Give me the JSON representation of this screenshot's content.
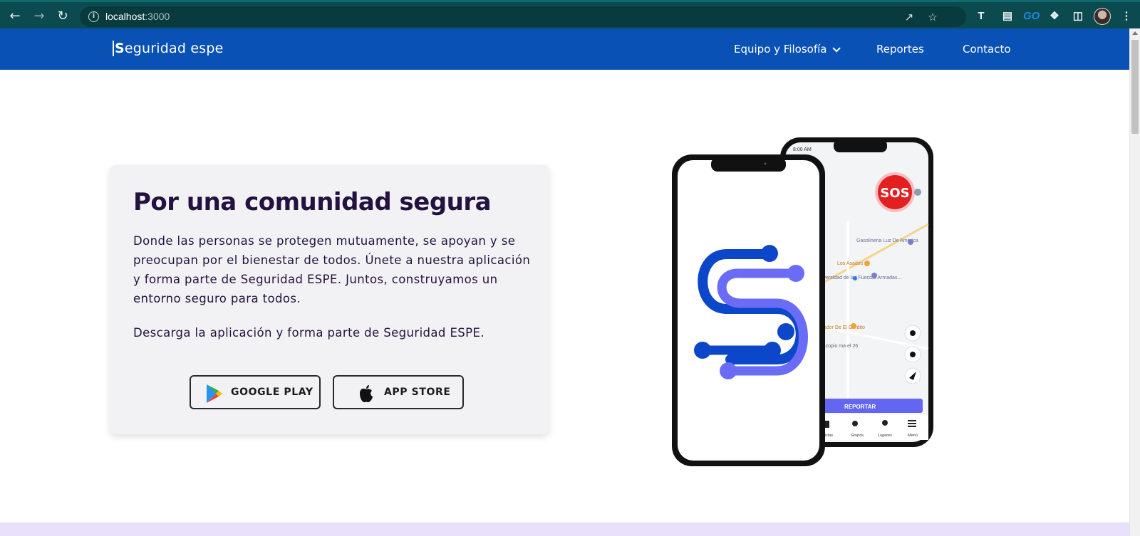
{
  "browser": {
    "url_host": "localhost",
    "url_port": ":3000",
    "extension_go_label": "GO"
  },
  "site": {
    "brand_rest": "eguridad espe",
    "brand_initial": "S",
    "nav": {
      "team": "Equipo y Filosofía",
      "reports": "Reportes",
      "contact": "Contacto"
    }
  },
  "hero": {
    "title": "Por una comunidad segura",
    "description": "Donde las personas se protegen mutuamente, se apoyan y se preocupan por el bienestar de todos. Únete a nuestra aplicación y forma parte de Seguridad ESPE. Juntos, construyamos un entorno seguro para todos.",
    "cta": "Descarga la aplicación y forma parte de Seguridad ESPE.",
    "google_play": "GOOGLE PLAY",
    "app_store": "APP STORE"
  },
  "phone_screen": {
    "time": "8:00 AM",
    "sos": "SOS",
    "places": [
      "Gasolineria Luz De America",
      "Los Asados",
      "Universidad de las Fuerzas Armadas...",
      "Parador De El Gordito",
      "de acopio ma el 26"
    ],
    "report_button": "REPORTAR",
    "tabs": [
      "icias",
      "Grupos",
      "Lugares",
      "Menú"
    ]
  },
  "colors": {
    "chrome": "#0b4a4f",
    "nav": "#0951b5",
    "heading": "#23123f",
    "logo_dark": "#0d47c9",
    "logo_light": "#6b6cf6",
    "sos": "#e32020",
    "report": "#6366f1"
  }
}
